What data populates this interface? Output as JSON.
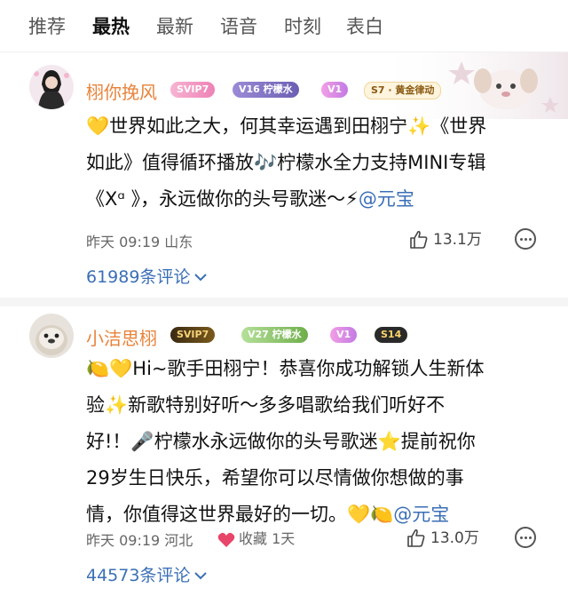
{
  "tabs": [
    "推荐",
    "最热",
    "最新",
    "语音",
    "时刻",
    "表白"
  ],
  "active_tab": "最热",
  "posts": [
    {
      "username": "栩你挽风",
      "badges": [
        "SVIP7",
        "V16 柠檬水",
        "V1",
        "S7 · 黄金律动"
      ],
      "lines": [
        [
          "💛世界如此之大，何其幸运遇到田栩宁✨《世界"
        ],
        [
          "如此》值得循环播放🎶柠檬水全力支持MINI专辑"
        ],
        [
          "《Xᵅ 》，永远做你的头号歌迷～⚡",
          "@元宝"
        ]
      ],
      "time": "昨天 09:19",
      "location": "山东",
      "likes": "13.1万",
      "comments": "61989条评论"
    },
    {
      "username": "小洁思栩",
      "badges": [
        "SVIP7",
        "V27 柠檬水",
        "V1",
        "S14"
      ],
      "lines": [
        [
          "🍋💛Hi~歌手田栩宁！恭喜你成功解锁人生新体"
        ],
        [
          "验✨新歌特别好听～多多唱歌给我们听好不"
        ],
        [
          "好!！🎤柠檬水永远做你的头号歌迷⭐提前祝你"
        ],
        [
          "29岁生日快乐，希望你可以尽情做你想做的事"
        ],
        [
          "情，你值得这世界最好的一切。💛🍋",
          "@元宝"
        ]
      ],
      "time": "昨天 09:19",
      "location": "河北",
      "collect": "收藏 1天",
      "likes": "13.0万",
      "comments": "44573条评论"
    }
  ],
  "colors": {
    "username": "#e8833a",
    "link": "#3b6fb6",
    "svip": "#f49ac1",
    "svip_gold": "#d9a21b",
    "lemon": "#6fae4a",
    "v1": "#d78cf0"
  }
}
